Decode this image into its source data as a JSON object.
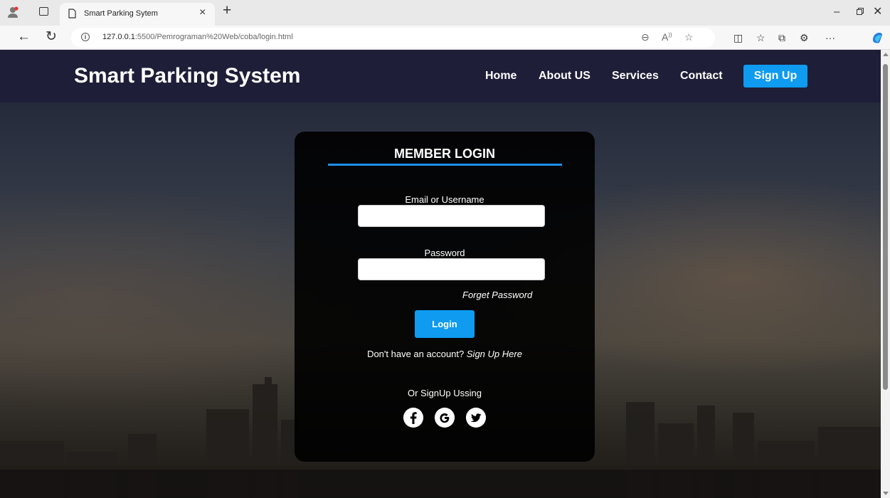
{
  "browser": {
    "tab_title": "Smart Parking Sytem",
    "url_host": "127.0.0.1",
    "url_path": ":5500/Pemrograman%20Web/coba/login.html",
    "icons": [
      "profile-icon",
      "tabs-icon",
      "page-icon",
      "close-tab-icon",
      "new-tab-icon",
      "minimize-icon",
      "restore-icon",
      "close-window-icon",
      "back-icon",
      "reload-icon",
      "info-icon",
      "zoom-out-icon",
      "read-aloud-icon",
      "favorite-icon",
      "split-screen-icon",
      "favorites-icon",
      "collections-icon",
      "extensions-icon",
      "more-icon",
      "copilot-icon"
    ]
  },
  "site": {
    "brand": "Smart Parking System",
    "nav": [
      "Home",
      "About US",
      "Services",
      "Contact"
    ],
    "signup_button": "Sign Up",
    "accent_color": "#0e9bf0",
    "nav_bg": "#1e1e38"
  },
  "login": {
    "title": "MEMBER LOGIN",
    "email_label": "Email or Username",
    "email_value": "",
    "password_label": "Password",
    "password_value": "",
    "forget_link": "Forget Password",
    "login_button": "Login",
    "no_account_text": "Don't have an account?",
    "signup_link": "Sign Up Here",
    "social_label": "Or SignUp Ussing",
    "social_icons": [
      "facebook-icon",
      "google-icon",
      "twitter-icon"
    ]
  }
}
